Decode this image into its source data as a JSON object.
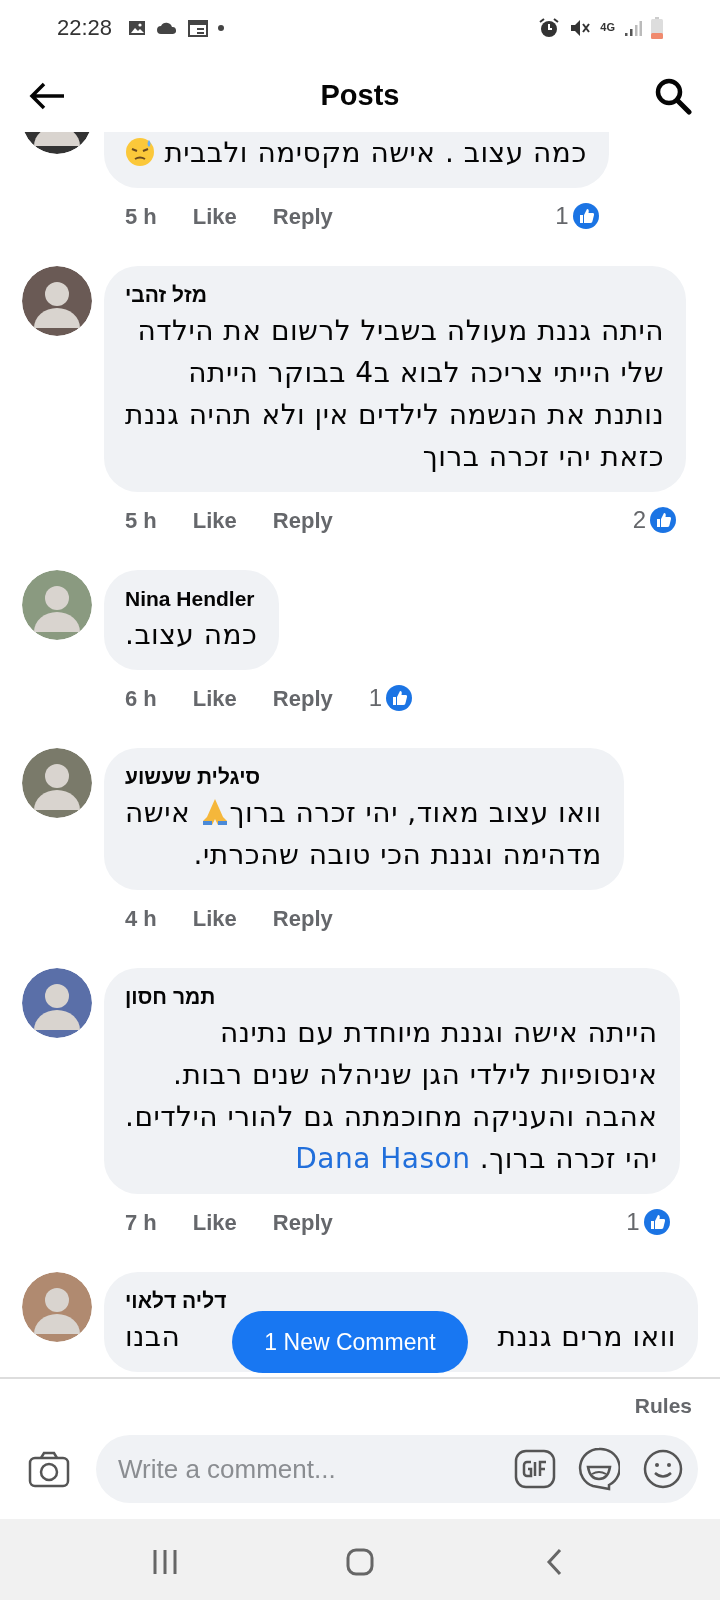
{
  "status_bar": {
    "time": "22:28",
    "network": "4G"
  },
  "header": {
    "title": "Posts"
  },
  "comments": [
    {
      "lines": [
        [
          {
            "kind": "text",
            "text": "כמה עצוב . אישה מקסימה ולבבית "
          },
          {
            "kind": "sadface"
          }
        ]
      ],
      "time": "5 h",
      "like": "Like",
      "reply": "Reply",
      "likes": "1"
    },
    {
      "author": "מזל זהבי",
      "lines": [
        [
          {
            "kind": "text",
            "text": "היתה גננת מעולה בשביל לרשום את הילדה"
          }
        ],
        [
          {
            "kind": "text",
            "text": "שלי הייתי צריכה לבוא ב4 בבוקר הייתה"
          }
        ],
        [
          {
            "kind": "text",
            "text": "נותנת את הנשמה לילדים אין ולא תהיה גננת"
          }
        ],
        [
          {
            "kind": "text",
            "text": "כזאת יהי זכרה ברוך"
          }
        ]
      ],
      "time": "5 h",
      "like": "Like",
      "reply": "Reply",
      "likes": "2"
    },
    {
      "author": "Nina Hendler",
      "lines": [
        [
          {
            "kind": "text",
            "text": "כמה עצוב."
          }
        ]
      ],
      "time": "6 h",
      "like": "Like",
      "reply": "Reply",
      "likes": "1"
    },
    {
      "author": "סיגלית שעשוע",
      "lines": [
        [
          {
            "kind": "text",
            "text": "וואו עצוב מאוד, יהי זכרה ברוך"
          },
          {
            "kind": "prayer"
          },
          {
            "kind": "text",
            "text": " אישה"
          }
        ],
        [
          {
            "kind": "text",
            "text": "מדהימה וגננת  הכי טובה שהכרתי."
          }
        ]
      ],
      "time": "4 h",
      "like": "Like",
      "reply": "Reply"
    },
    {
      "author": "תמר חסון",
      "lines": [
        [
          {
            "kind": "text",
            "text": "הייתה אישה וגננת מיוחדת עם נתינה"
          }
        ],
        [
          {
            "kind": "text",
            "text": "אינסופיות לילדי הגן שניהלה שנים רבות."
          }
        ],
        [
          {
            "kind": "text",
            "text": "אהבה והעניקה מחוכמתה גם להורי הילדים."
          }
        ],
        [
          {
            "kind": "text",
            "text": "יהי זכרה ברוך. "
          },
          {
            "kind": "mention",
            "text": "Dana Hason"
          }
        ]
      ],
      "time": "7 h",
      "like": "Like",
      "reply": "Reply",
      "likes": "1"
    },
    {
      "author": "דליה דלאוי",
      "lines": [
        [
          {
            "kind": "text",
            "text": "וואו מרים גננת"
          },
          {
            "kind": "covered"
          },
          {
            "kind": "text",
            "text": "הבנו"
          }
        ]
      ]
    }
  ],
  "new_comments_button": "1 New Comment",
  "rules_link": "Rules",
  "composer": {
    "placeholder": "Write a comment..."
  }
}
